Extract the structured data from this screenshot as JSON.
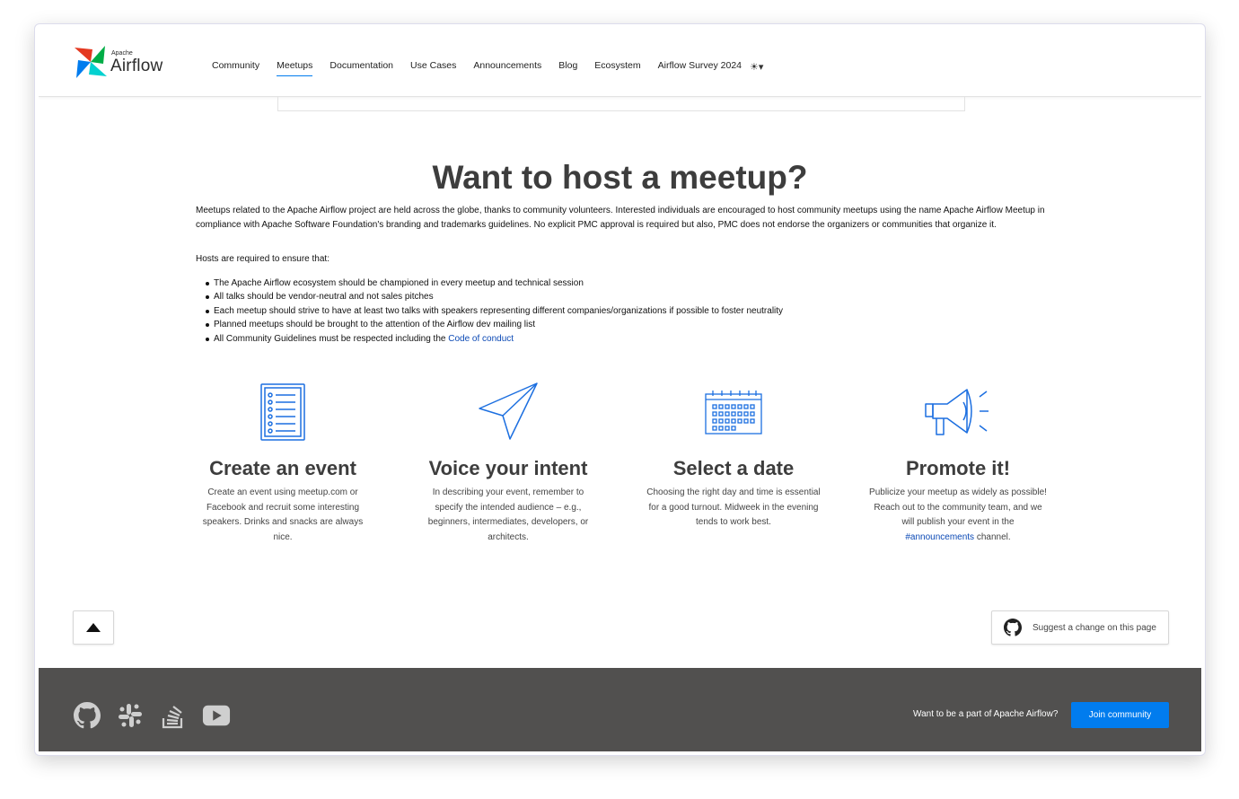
{
  "brand": {
    "apache": "Apache",
    "airflow": "Airflow"
  },
  "nav": {
    "items": [
      {
        "label": "Community",
        "active": false
      },
      {
        "label": "Meetups",
        "active": true
      },
      {
        "label": "Documentation",
        "active": false
      },
      {
        "label": "Use Cases",
        "active": false
      },
      {
        "label": "Announcements",
        "active": false
      },
      {
        "label": "Blog",
        "active": false
      },
      {
        "label": "Ecosystem",
        "active": false
      },
      {
        "label": "Airflow Survey 2024",
        "active": false
      }
    ],
    "theme_toggle": "☀▾"
  },
  "main": {
    "title": "Want to host a meetup?",
    "intro": "Meetups related to the Apache Airflow project are held across the globe, thanks to community volunteers. Interested individuals are encouraged to host community meetups using the name Apache Airflow Meetup in compliance with Apache Software Foundation's branding and trademarks guidelines. No explicit PMC approval is required but also, PMC does not endorse the organizers or communities that organize it.",
    "hosts_intro": "Hosts are required to ensure that:",
    "rules": [
      "The Apache Airflow ecosystem should be championed in every meetup and technical session",
      "All talks should be vendor-neutral and not sales pitches",
      "Each meetup should strive to have at least two talks with speakers representing different companies/organizations if possible to foster neutrality",
      "Planned meetups should be brought to the attention of the Airflow dev mailing list",
      "All Community Guidelines must be respected including the "
    ],
    "rules_link": "Code of conduct",
    "steps": [
      {
        "title": "Create an event",
        "text": "Create an event using meetup.com or Facebook and recruit some interesting speakers. Drinks and snacks are always nice.",
        "icon": "list-icon"
      },
      {
        "title": "Voice your intent",
        "text": "In describing your event, remember to specify the intended audience – e.g., beginners, intermediates, developers, or architects.",
        "icon": "paper-plane-icon"
      },
      {
        "title": "Select a date",
        "text": "Choosing the right day and time is essential for a good turnout. Midweek in the evening tends to work best.",
        "icon": "calendar-icon"
      },
      {
        "title": "Promote it!",
        "text_before": "Publicize your meetup as widely as possible! Reach out to the community team, and we will publish your event in the ",
        "link": "#announcements",
        "text_after": " channel.",
        "icon": "megaphone-icon"
      }
    ]
  },
  "actions": {
    "suggest_change": "Suggest a change on this page"
  },
  "footer": {
    "icons": [
      "github-icon",
      "slack-icon",
      "stackoverflow-icon",
      "youtube-icon"
    ],
    "cta_text": "Want to be a part of Apache Airflow?",
    "join_label": "Join community"
  },
  "colors": {
    "accent": "#017cee",
    "link": "#0b49b5",
    "footer_bg": "#51504f"
  }
}
